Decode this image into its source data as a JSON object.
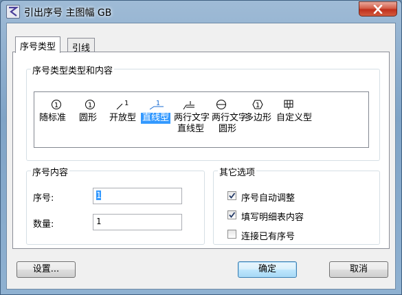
{
  "window": {
    "title": "引出序号 主图幅 GB"
  },
  "tabs": [
    {
      "label": "序号类型",
      "active": true
    },
    {
      "label": "引线",
      "active": false
    }
  ],
  "type_group": {
    "label": "序号类型类型和内容",
    "symbols": [
      "1",
      "1",
      "1",
      "1",
      "1"
    ],
    "items": [
      {
        "label": "随标准",
        "selected": false
      },
      {
        "label": "圆形",
        "selected": false
      },
      {
        "label": "开放型",
        "selected": false
      },
      {
        "label": "直线型",
        "selected": true
      },
      {
        "label": "两行文字",
        "label2": "直线型",
        "selected": false
      },
      {
        "label": "两行文字",
        "label2": "圆形",
        "selected": false
      },
      {
        "label": "多边形",
        "selected": false
      },
      {
        "label": "自定义型",
        "selected": false
      }
    ]
  },
  "content_group": {
    "label": "序号内容",
    "number_label": "序号:",
    "number_value": "1",
    "quantity_label": "数量:",
    "quantity_value": "1"
  },
  "other_group": {
    "label": "其它选项",
    "options": [
      {
        "label": "序号自动调整",
        "checked": true
      },
      {
        "label": "填写明细表内容",
        "checked": true
      },
      {
        "label": "连接已有序号",
        "checked": false
      }
    ]
  },
  "buttons": {
    "settings": "设置...",
    "ok": "确定",
    "cancel": "取消"
  },
  "colors": {
    "selection": "#3399ff",
    "close": "#c7412a"
  }
}
